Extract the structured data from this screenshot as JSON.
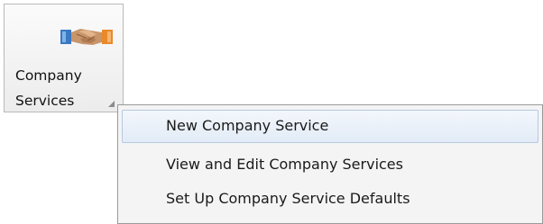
{
  "ribbon_button": {
    "label_line1": "Company",
    "label_line2": "Services",
    "icon": "handshake-icon"
  },
  "menu": {
    "items": [
      {
        "label": "New Company Service",
        "highlighted": true
      },
      {
        "label": "View and Edit Company Services",
        "highlighted": false
      },
      {
        "label": "Set Up Company Service Defaults",
        "highlighted": false
      }
    ]
  },
  "colors": {
    "highlight_border": "#b5c9e3",
    "highlight_fill": "#e2ebf6",
    "menu_background": "#f4f4f4",
    "icon_blue": "#3a78c2",
    "icon_orange": "#e8892b"
  }
}
